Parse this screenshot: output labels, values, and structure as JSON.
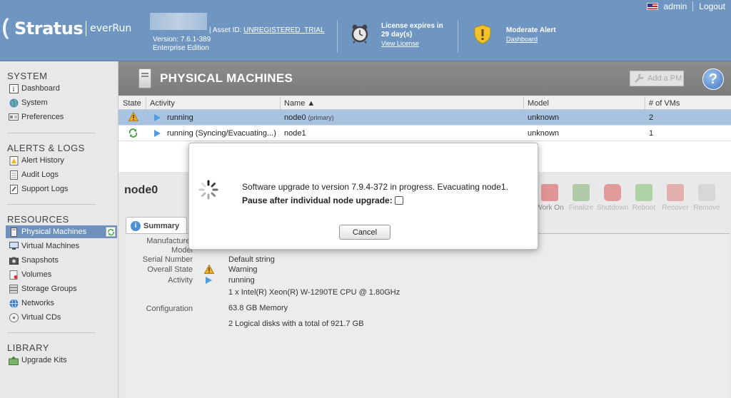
{
  "header": {
    "brand": "Stratus",
    "product": "everRun",
    "version": "Version: 7.6.1-389",
    "edition": "Enterprise Edition",
    "asset_label": "| Asset ID:",
    "asset_id": "UNREGISTERED_TRIAL",
    "license_line1": "License expires in",
    "license_line2": "29 day(s)",
    "license_link": "View License",
    "alert_title": "Moderate Alert",
    "alert_link": "Dashboard",
    "user": "admin",
    "logout": "Logout"
  },
  "sidebar": {
    "system_title": "SYSTEM",
    "alerts_title": "ALERTS & LOGS",
    "resources_title": "RESOURCES",
    "library_title": "LIBRARY",
    "system_items": [
      "Dashboard",
      "System",
      "Preferences"
    ],
    "alerts_items": [
      "Alert History",
      "Audit Logs",
      "Support Logs"
    ],
    "resources_items": [
      "Physical Machines",
      "Virtual Machines",
      "Snapshots",
      "Volumes",
      "Storage Groups",
      "Networks",
      "Virtual CDs"
    ],
    "library_items": [
      "Upgrade Kits"
    ]
  },
  "main": {
    "title": "PHYSICAL MACHINES",
    "add_pm": "Add a PM",
    "help": "?",
    "columns": [
      "State",
      "Activity",
      "Name ▲",
      "Model",
      "# of VMs"
    ],
    "rows": [
      {
        "activity": "running",
        "name": "node0",
        "name_note": "(primary)",
        "model": "unknown",
        "vms": "2"
      },
      {
        "activity": "running (Syncing/Evacuating...)",
        "name": "node1",
        "name_note": "",
        "model": "unknown",
        "vms": "1"
      }
    ],
    "node_title": "node0",
    "actions": [
      "Work On",
      "Finalize",
      "Shutdown",
      "Reboot",
      "Recover",
      "Remove"
    ],
    "tab": "Summary",
    "summary": {
      "manufacturer_label": "Manufacturer",
      "model_label": "Model",
      "serial_label": "Serial Number",
      "serial_value": "Default string",
      "state_label": "Overall State",
      "state_value": "Warning",
      "activity_label": "Activity",
      "activity_value": "running",
      "config_label": "Configuration",
      "cpu": "1 x Intel(R) Xeon(R) W-1290TE CPU @ 1.80GHz",
      "memory": "63.8 GB Memory",
      "disks": "2 Logical disks with a total of 921.7 GB"
    }
  },
  "modal": {
    "message": "Software upgrade to version 7.9.4-372 in progress. Evacuating node1.",
    "pause_label": "Pause after individual node upgrade:",
    "cancel": "Cancel"
  },
  "colors": {
    "header_bg": "#6f96c0",
    "selected_row": "#a8c3e2",
    "sidebar_active": "#6e92bd",
    "warning": "#f2b01e",
    "sync": "#3ea83e"
  }
}
